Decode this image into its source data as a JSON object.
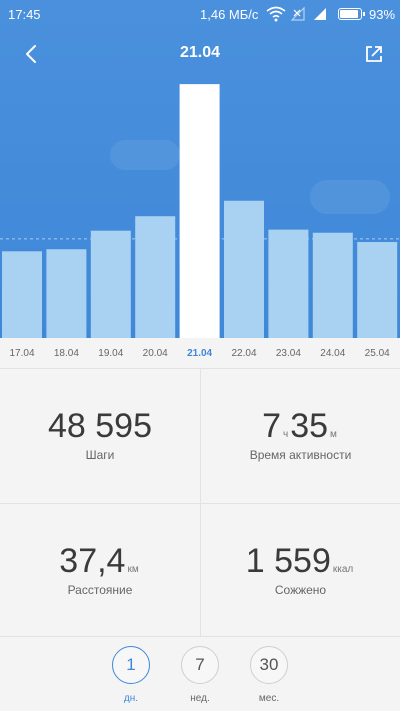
{
  "status_bar": {
    "time": "17:45",
    "net_speed": "1,46 МБ/с",
    "battery_percent": "93%",
    "battery_level": 0.93
  },
  "header": {
    "title": "21.04"
  },
  "colors": {
    "header_bg": "#4a90dd",
    "bar": "#a9d1f1",
    "bar_selected": "#ffffff",
    "accent": "#3f88d8"
  },
  "chart_data": {
    "type": "bar",
    "categories": [
      "17.04",
      "18.04",
      "19.04",
      "20.04",
      "21.04",
      "22.04",
      "23.04",
      "24.04",
      "25.04"
    ],
    "values": [
      8.4,
      8.6,
      10.4,
      11.8,
      24.6,
      13.3,
      10.5,
      10.2,
      9.3
    ],
    "selected_index": 4,
    "ylim": [
      0,
      25
    ],
    "average_line": 9.6,
    "xlabel": "",
    "ylabel": ""
  },
  "stats": {
    "steps": {
      "value": "48 595",
      "label": "Шаги"
    },
    "active_time": {
      "hours": "7",
      "hours_unit": "ч",
      "minutes": "35",
      "minutes_unit": "м",
      "label": "Время активности"
    },
    "distance": {
      "value": "37,4",
      "unit": "км",
      "label": "Расстояние"
    },
    "calories": {
      "value": "1 559",
      "unit": "ккал",
      "label": "Сожжено"
    }
  },
  "periods": [
    {
      "value": "1",
      "label": "дн.",
      "selected": true
    },
    {
      "value": "7",
      "label": "нед.",
      "selected": false
    },
    {
      "value": "30",
      "label": "мес.",
      "selected": false
    }
  ]
}
